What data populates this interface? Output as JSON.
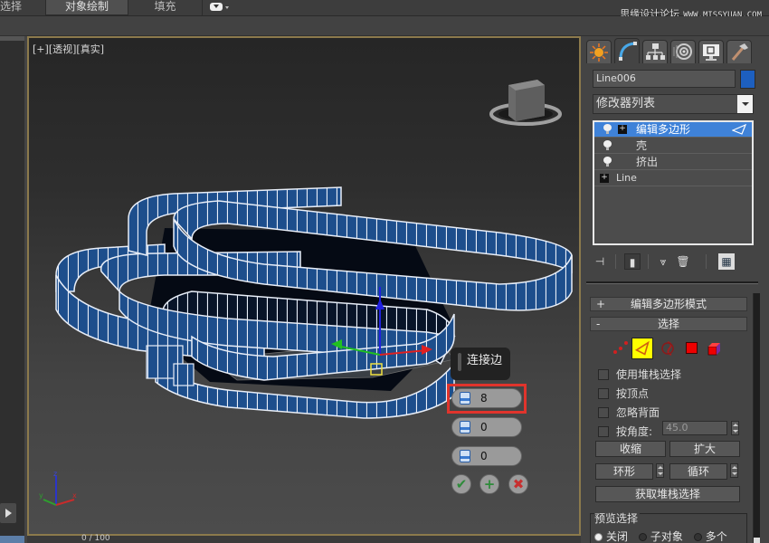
{
  "ribbon": {
    "tabs": [
      {
        "label": "选择",
        "active": false
      },
      {
        "label": "对象绘制",
        "active": true
      },
      {
        "label": "填充",
        "active": false
      }
    ],
    "extra_dropdown_icon": "toggle-pill-icon"
  },
  "watermark": {
    "site_name": "思缘设计论坛",
    "url": "WWW.MISSYUAN.COM"
  },
  "viewport": {
    "labels": [
      "[+]",
      "[透视]",
      "[真实]"
    ],
    "viewcube_icon": "viewcube-icon",
    "axis_labels": {
      "z": "z",
      "y": "y",
      "x": "x"
    },
    "model_color": "#1d4e8c",
    "border_color": "#8c7a4c"
  },
  "caddy": {
    "title": "连接边",
    "fields": [
      {
        "name": "segments",
        "icon": "segments-icon",
        "value": "8",
        "highlighted": true
      },
      {
        "name": "pinch",
        "icon": "pinch-icon",
        "value": "0"
      },
      {
        "name": "slide",
        "icon": "slide-icon",
        "value": "0"
      }
    ],
    "buttons": [
      {
        "name": "ok",
        "glyph": "✔"
      },
      {
        "name": "apply-continue",
        "glyph": "+"
      },
      {
        "name": "cancel",
        "glyph": "✖"
      }
    ],
    "highlight_color": "#e0342c"
  },
  "timeline": {
    "frame_text": "0 / 100"
  },
  "command_panel": {
    "tabs": [
      "create",
      "modify",
      "hierarchy",
      "motion",
      "display",
      "utilities"
    ],
    "active_tab": "modify",
    "object_name": "Line006",
    "object_color": "#1d5fbf",
    "modifier_list_label": "修改器列表",
    "stack": [
      {
        "label": "编辑多边形",
        "selected": true,
        "has_bulb": true,
        "expandable": true,
        "sub_icon": "edge-triangle-icon"
      },
      {
        "label": "壳",
        "selected": false,
        "has_bulb": true,
        "expandable": false
      },
      {
        "label": "挤出",
        "selected": false,
        "has_bulb": true,
        "expandable": false
      },
      {
        "label": "Line",
        "selected": false,
        "has_bulb": false,
        "expandable": true
      }
    ],
    "stack_tools": [
      "pin-stack-icon",
      "show-end-result-icon",
      "make-unique-icon",
      "remove-modifier-icon",
      "configure-sets-icon"
    ],
    "rollouts": [
      {
        "sign": "+",
        "title": "编辑多边形模式"
      },
      {
        "sign": "-",
        "title": "选择"
      }
    ],
    "selection": {
      "subobject_icons": [
        "vertex-icon",
        "edge-icon",
        "border-icon",
        "polygon-icon",
        "element-icon"
      ],
      "active_subobject": "edge",
      "checkboxes": [
        {
          "label": "使用堆栈选择",
          "checked": false
        },
        {
          "label": "按顶点",
          "checked": false
        },
        {
          "label": "忽略背面",
          "checked": false
        },
        {
          "label": "按角度:",
          "checked": false
        }
      ],
      "angle_value": "45.0",
      "buttons": {
        "shrink": "收缩",
        "grow": "扩大",
        "ring": "环形",
        "loop": "循环",
        "get_stack_selection": "获取堆栈选择"
      },
      "preview": {
        "title": "预览选择",
        "options": [
          {
            "label": "关闭",
            "selected": true
          },
          {
            "label": "子对象",
            "selected": false
          },
          {
            "label": "多个",
            "selected": false
          }
        ]
      }
    }
  }
}
